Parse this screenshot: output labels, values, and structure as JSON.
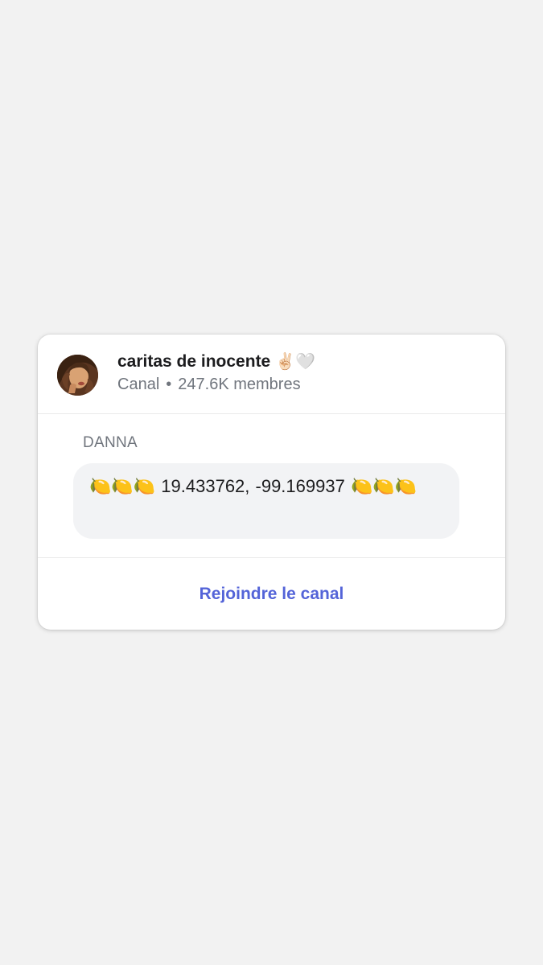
{
  "channel": {
    "name": "caritas de inocente",
    "name_emoji": "✌🏻🤍",
    "type": "Canal",
    "separator": "•",
    "members": "247.6K membres"
  },
  "message": {
    "sender": "DANNA",
    "text": "🍋🍋🍋 19.433762, -99.169937 🍋🍋🍋"
  },
  "action": {
    "join_label": "Rejoindre le canal"
  },
  "colors": {
    "accent": "#5464d8",
    "background": "#f2f2f2",
    "card": "#ffffff",
    "bubble": "#f2f3f5",
    "secondary_text": "#70757d"
  }
}
